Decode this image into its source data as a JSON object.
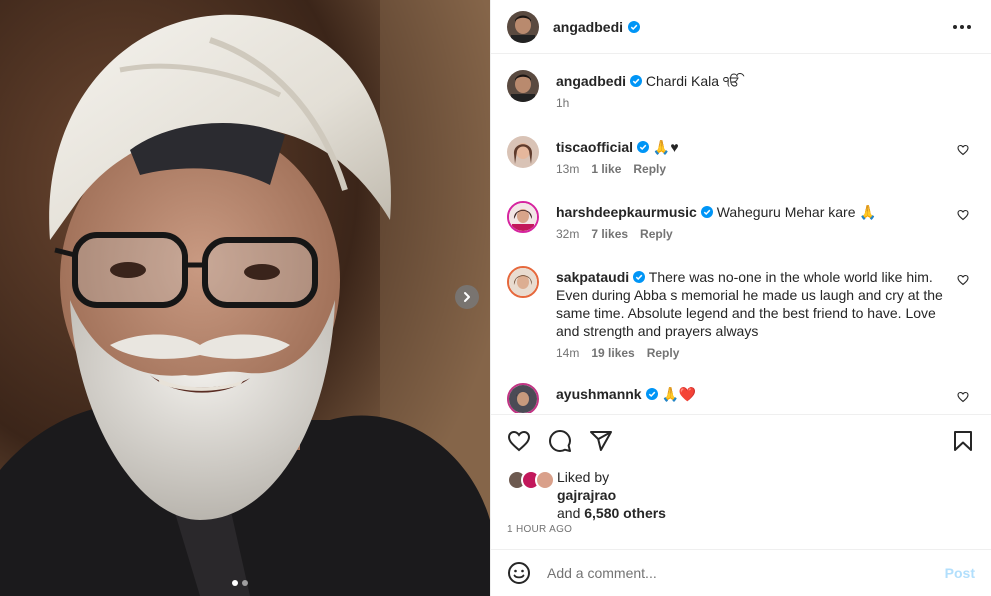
{
  "post": {
    "author": "angadbedi",
    "caption_author": "angadbedi",
    "caption": "Chardi Kala ੴ",
    "caption_time": "1h"
  },
  "comments": [
    {
      "user": "tiscaofficial",
      "text": "🙏♥",
      "time": "13m",
      "likes": "1 like",
      "reply": "Reply"
    },
    {
      "user": "harshdeepkaurmusic",
      "text": "Waheguru Mehar kare 🙏",
      "time": "32m",
      "likes": "7 likes",
      "reply": "Reply"
    },
    {
      "user": "sakpataudi",
      "text": "There was no-one in the whole world like him. Even during Abba s memorial he made us laugh and cry at the same time. Absolute legend and the best friend to have. Love and strength and prayers always",
      "time": "14m",
      "likes": "19 likes",
      "reply": "Reply"
    },
    {
      "user": "ayushmannk",
      "text": "🙏❤️",
      "time": "",
      "likes": "",
      "reply": ""
    }
  ],
  "likes": {
    "liked_by": "Liked by",
    "user": "gajrajrao",
    "and": "and",
    "others": "6,580 others"
  },
  "timestamp": "1 HOUR AGO",
  "comment_box": {
    "placeholder": "Add a comment...",
    "post_label": "Post"
  },
  "icons": {
    "verified": "verified-badge-icon",
    "heart": "heart-icon",
    "comment": "comment-icon",
    "share": "share-icon",
    "save": "bookmark-icon",
    "emoji": "emoji-icon",
    "more": "more-icon",
    "next": "chevron-right-icon"
  },
  "colors": {
    "verified": "#0095f6",
    "text": "#262626",
    "muted": "#737373",
    "post_disabled": "#b2dffc"
  }
}
